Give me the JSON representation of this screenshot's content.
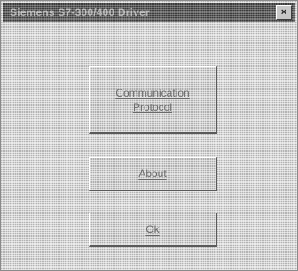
{
  "window": {
    "title": "Siemens S7-300/400 Driver",
    "close_glyph": "×"
  },
  "buttons": {
    "communication_protocol": "Communication Protocol",
    "about": "About",
    "ok": "Ok"
  }
}
